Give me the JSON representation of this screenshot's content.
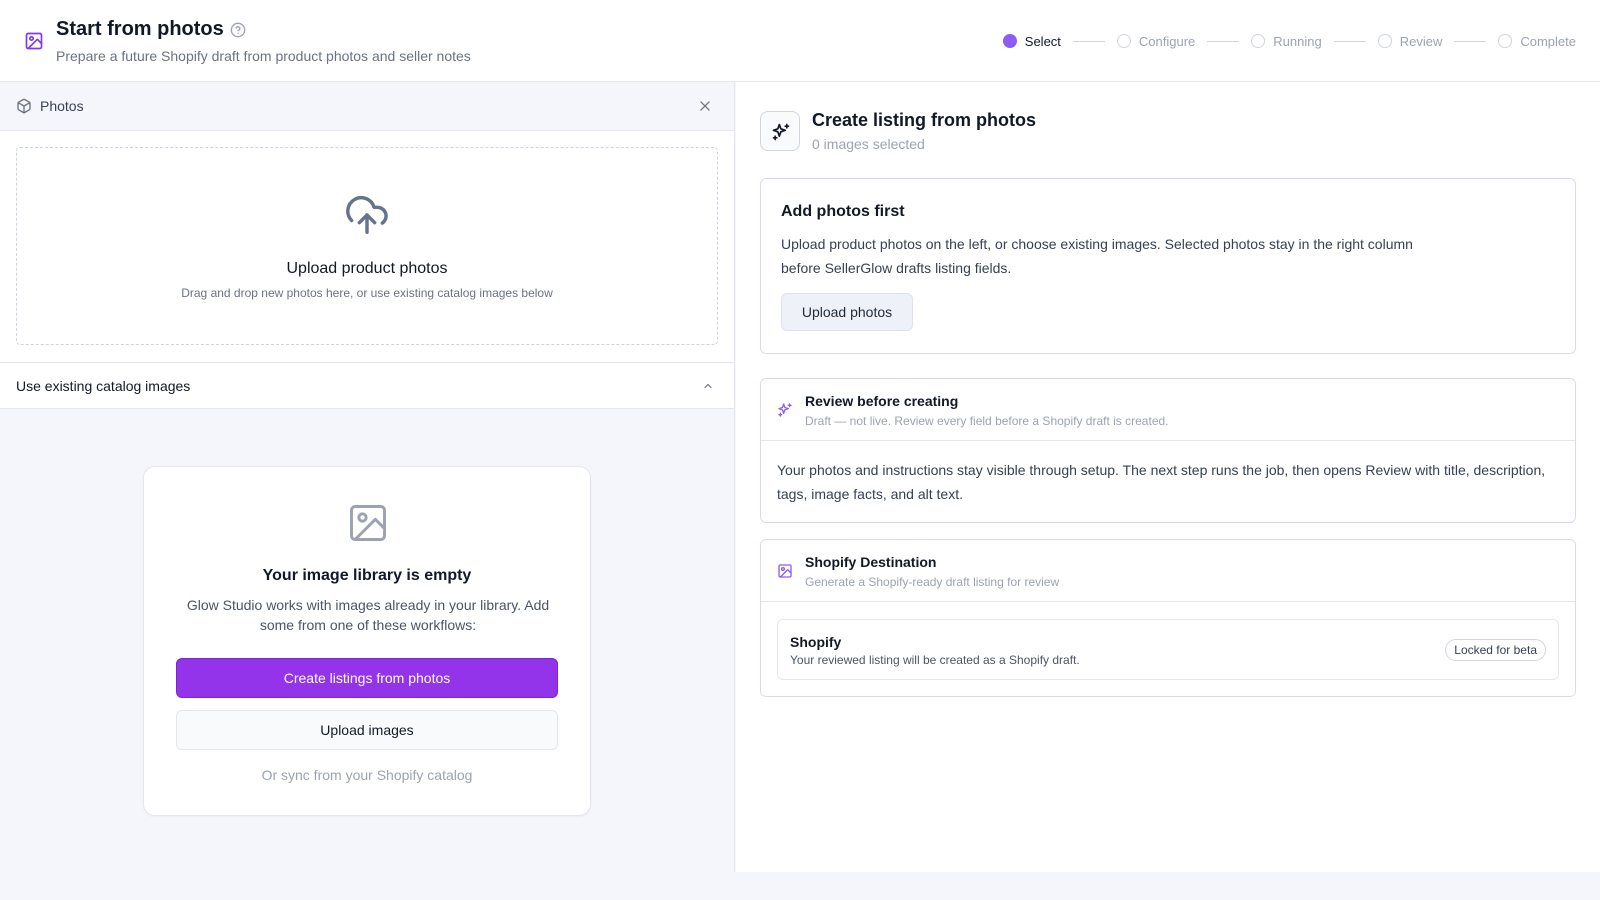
{
  "header": {
    "title": "Start from photos",
    "subtitle": "Prepare a future Shopify draft from product photos and seller notes",
    "icon": "image-icon",
    "help_icon": "help-circle-icon"
  },
  "stepper": {
    "steps": [
      {
        "label": "Select",
        "active": true
      },
      {
        "label": "Configure",
        "active": false
      },
      {
        "label": "Running",
        "active": false
      },
      {
        "label": "Review",
        "active": false
      },
      {
        "label": "Complete",
        "active": false
      }
    ]
  },
  "left": {
    "photos_label": "Photos",
    "upload": {
      "title": "Upload product photos",
      "subtitle": "Drag and drop new photos here, or use existing catalog images below"
    },
    "catalog": {
      "label": "Use existing catalog images"
    },
    "empty": {
      "title": "Your image library is empty",
      "description": "Glow Studio works with images already in your library. Add some from one of these workflows:",
      "primary_button": "Create listings from photos",
      "secondary_button": "Upload images",
      "sync_link": "Or sync from your Shopify catalog"
    }
  },
  "right": {
    "title": "Create listing from photos",
    "subtitle": "0 images selected",
    "add_photos": {
      "title": "Add photos first",
      "description": "Upload product photos on the left, or choose existing images. Selected photos stay in the right column before SellerGlow drafts listing fields.",
      "button": "Upload photos"
    },
    "review": {
      "title": "Review before creating",
      "subtitle": "Draft — not live. Review every field before a Shopify draft is created.",
      "body": "Your photos and instructions stay visible through setup. The next step runs the job, then opens Review with title, description, tags, image facts, and alt text."
    },
    "destination": {
      "title": "Shopify Destination",
      "subtitle": "Generate a Shopify-ready draft listing for review",
      "item_title": "Shopify",
      "item_subtitle": "Your reviewed listing will be created as a Shopify draft.",
      "badge": "Locked for beta"
    }
  },
  "colors": {
    "accent": "#8b5cf6",
    "primary_button": "#9333ea"
  }
}
